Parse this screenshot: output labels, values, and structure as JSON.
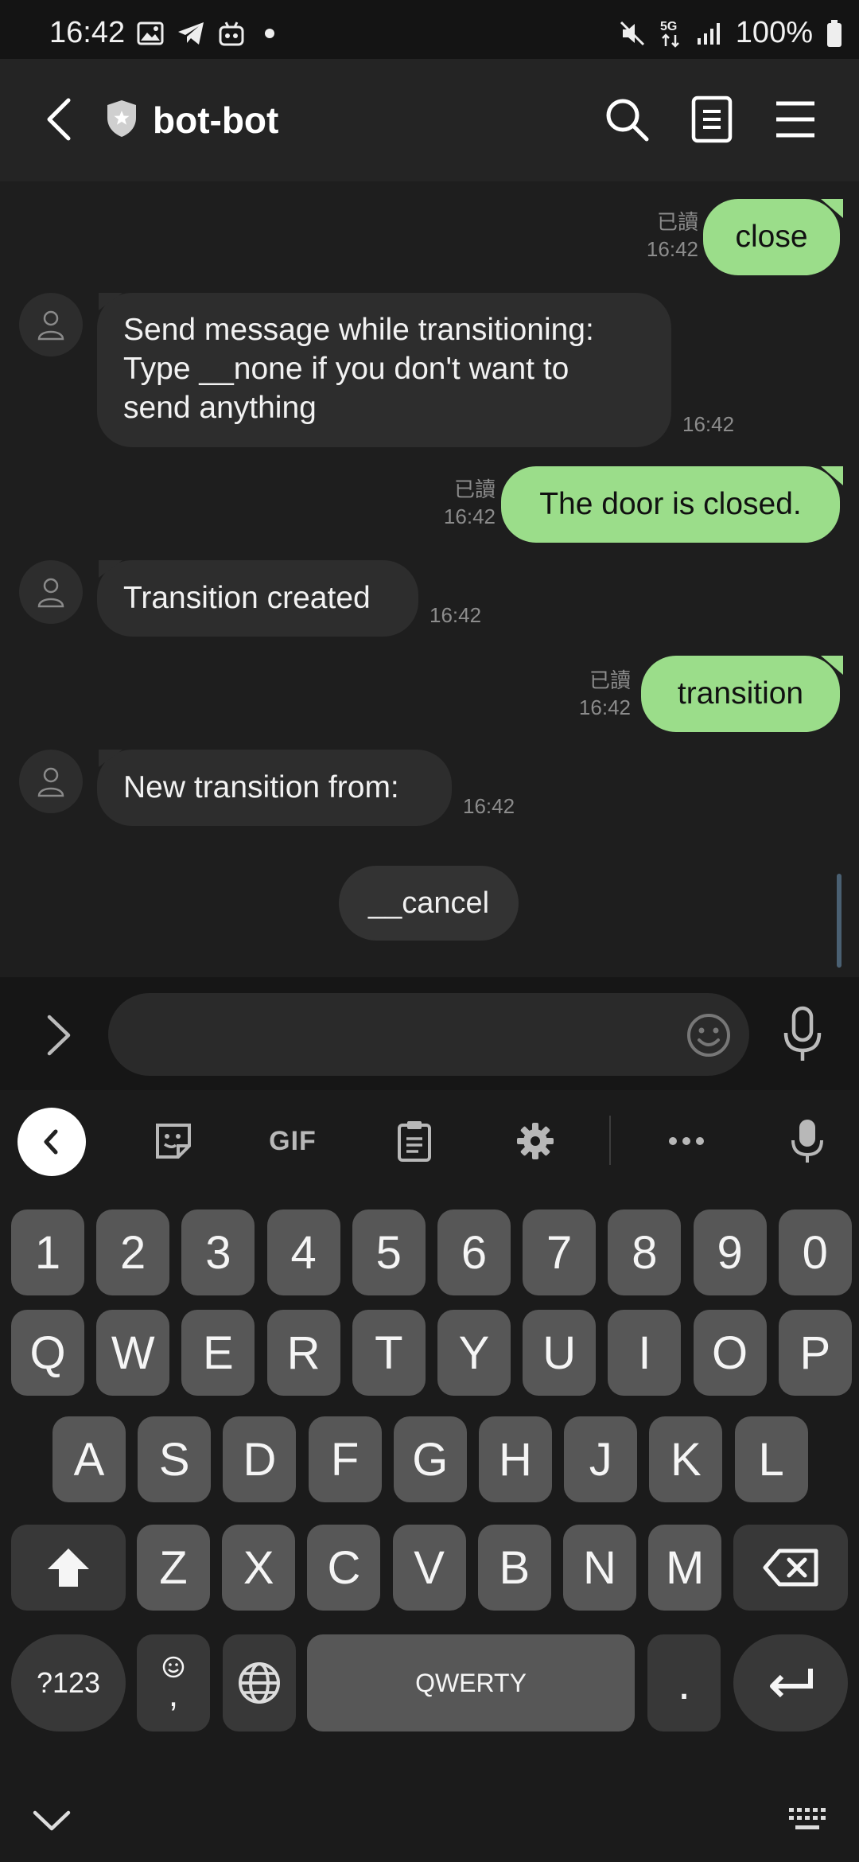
{
  "status_bar": {
    "time": "16:42",
    "left_icons": [
      "gallery-icon",
      "telegram-icon",
      "bot-app-icon",
      "dot-icon"
    ],
    "right_icons": [
      "mute-icon",
      "5g-icon",
      "signal-icon",
      "battery-icon"
    ],
    "network": "5G",
    "battery": "100%"
  },
  "header": {
    "title": "bot-bot",
    "icons": [
      "back-icon",
      "shield-icon",
      "search-icon",
      "notes-icon",
      "menu-icon"
    ]
  },
  "messages": [
    {
      "direction": "out",
      "text": "close",
      "read_label": "已讀",
      "time": "16:42"
    },
    {
      "direction": "in",
      "text": "Send message while transitioning: Type __none if you don't want to send anything",
      "lines": [
        "Send message while transitioning:",
        "Type __none if you don't want to",
        "send anything"
      ],
      "time": "16:42"
    },
    {
      "direction": "out",
      "text": "The door is closed.",
      "read_label": "已讀",
      "time": "16:42"
    },
    {
      "direction": "in",
      "text": "Transition created",
      "time": "16:42"
    },
    {
      "direction": "out",
      "text": "transition",
      "read_label": "已讀",
      "time": "16:42"
    },
    {
      "direction": "in",
      "text": "New transition from:",
      "time": "16:42"
    }
  ],
  "quick_reply": "__cancel",
  "input_bar": {
    "placeholder": "",
    "icons": [
      "expand-icon",
      "emoji-icon",
      "mic-icon"
    ]
  },
  "keyboard": {
    "toolbar": {
      "gif_label": "GIF",
      "icons": [
        "collapse-toolbar-icon",
        "sticker-icon",
        "clipboard-icon",
        "settings-icon",
        "more-icon",
        "voice-input-icon"
      ]
    },
    "number_row": [
      "1",
      "2",
      "3",
      "4",
      "5",
      "6",
      "7",
      "8",
      "9",
      "0"
    ],
    "row1": [
      "Q",
      "W",
      "E",
      "R",
      "T",
      "Y",
      "U",
      "I",
      "O",
      "P"
    ],
    "row2": [
      "A",
      "S",
      "D",
      "F",
      "G",
      "H",
      "J",
      "K",
      "L"
    ],
    "row3": [
      "Z",
      "X",
      "C",
      "V",
      "B",
      "N",
      "M"
    ],
    "symbols_label": "?123",
    "comma": ",",
    "space_label": "QWERTY",
    "period": ".",
    "bottom_icons": [
      "hide-keyboard-icon",
      "keyboard-switch-icon"
    ]
  },
  "colors": {
    "outgoing_bubble": "#9bdd8a",
    "incoming_bubble": "#2d2d2d",
    "background": "#1e1e1e"
  }
}
